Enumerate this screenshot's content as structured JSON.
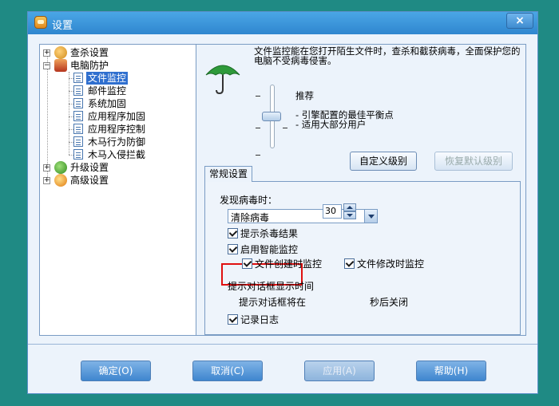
{
  "window": {
    "title": "设置",
    "close_glyph": "×"
  },
  "tree": {
    "items": [
      {
        "label": "查杀设置",
        "icon": "scan-settings-icon"
      },
      {
        "label": "电脑防护",
        "icon": "shield-icon"
      },
      {
        "label": "文件监控",
        "icon": "page-icon"
      },
      {
        "label": "邮件监控",
        "icon": "page-icon"
      },
      {
        "label": "系统加固",
        "icon": "page-icon"
      },
      {
        "label": "应用程序加固",
        "icon": "page-icon"
      },
      {
        "label": "应用程序控制",
        "icon": "page-icon"
      },
      {
        "label": "木马行为防御",
        "icon": "page-icon"
      },
      {
        "label": "木马入侵拦截",
        "icon": "page-icon"
      },
      {
        "label": "升级设置",
        "icon": "update-icon"
      },
      {
        "label": "高级设置",
        "icon": "advanced-settings-icon"
      }
    ]
  },
  "description": "文件监控能在您打开陌生文件时，查杀和截获病毒，全面保护您的电脑不受病毒侵害。",
  "level": {
    "name": "推荐",
    "line1": "- 引擎配置的最佳平衡点",
    "line2": "- 适用大部分用户",
    "tick_glyph": "-"
  },
  "buttons": {
    "custom": "自定义级别",
    "restore": "恢复默认级别"
  },
  "tab": {
    "label": "常规设置"
  },
  "form": {
    "virus_found_label": "发现病毒时：",
    "action_value": "清除病毒",
    "show_result": "提示杀毒结果",
    "smart_monitor": "启用智能监控",
    "file_create": "文件创建时监控",
    "file_modify": "文件修改时监控",
    "dialog_time_label": "提示对话框显示时间",
    "dialog_prefix": "提示对话框将在",
    "dialog_seconds": "30",
    "dialog_suffix": "秒后关闭",
    "log": "记录日志"
  },
  "footer": {
    "ok": "确定(O)",
    "cancel": "取消(C)",
    "apply": "应用(A)",
    "help": "帮助(H)"
  },
  "colors": {
    "background": "#1f8a84",
    "highlight": "#e01010",
    "selection": "#2f6fcf"
  }
}
